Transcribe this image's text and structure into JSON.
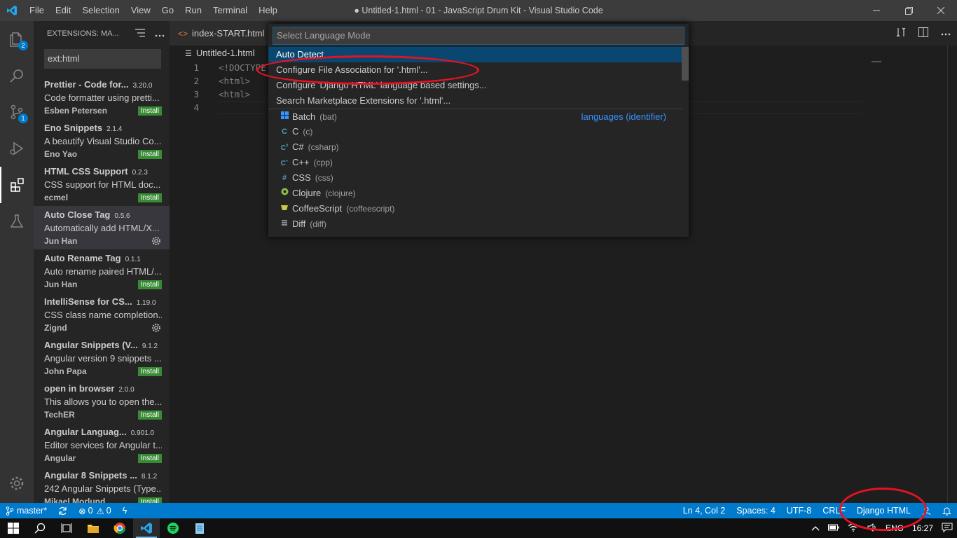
{
  "titlebar": {
    "menu": [
      "File",
      "Edit",
      "Selection",
      "View",
      "Go",
      "Run",
      "Terminal",
      "Help"
    ],
    "title": "● Untitled-1.html - 01 - JavaScript Drum Kit - Visual Studio Code"
  },
  "activitybar": {
    "explorer_badge": "2",
    "scm_badge": "1"
  },
  "sidebar": {
    "title": "EXTENSIONS: MA...",
    "search_value": "ext:html",
    "extensions": [
      {
        "name": "Prettier - Code for...",
        "version": "3.20.0",
        "desc": "Code formatter using pretti...",
        "author": "Esben Petersen",
        "action": "Install"
      },
      {
        "name": "Eno Snippets",
        "version": "2.1.4",
        "desc": "A beautify Visual Studio Co...",
        "author": "Eno Yao",
        "action": "Install"
      },
      {
        "name": "HTML CSS Support",
        "version": "0.2.3",
        "desc": "CSS support for HTML doc...",
        "author": "ecmel",
        "action": "Install"
      },
      {
        "name": "Auto Close Tag",
        "version": "0.5.6",
        "desc": "Automatically add HTML/X...",
        "author": "Jun Han",
        "action": ""
      },
      {
        "name": "Auto Rename Tag",
        "version": "0.1.1",
        "desc": "Auto rename paired HTML/...",
        "author": "Jun Han",
        "action": "Install"
      },
      {
        "name": "IntelliSense for CS...",
        "version": "1.19.0",
        "desc": "CSS class name completion...",
        "author": "Zignd",
        "action": ""
      },
      {
        "name": "Angular Snippets (V...",
        "version": "9.1.2",
        "desc": "Angular version 9 snippets ...",
        "author": "John Papa",
        "action": "Install"
      },
      {
        "name": "open in browser",
        "version": "2.0.0",
        "desc": "This allows you to open the...",
        "author": "TechER",
        "action": "Install"
      },
      {
        "name": "Angular Languag...",
        "version": "0.901.0",
        "desc": "Editor services for Angular t...",
        "author": "Angular",
        "action": "Install"
      },
      {
        "name": "Angular 8 Snippets ...",
        "version": "8.1.2",
        "desc": "242 Angular Snippets (Type...",
        "author": "Mikael Morlund",
        "action": "Install"
      }
    ]
  },
  "editor": {
    "tab_label": "index-START.html",
    "breadcrumb": "Untitled-1.html",
    "lines": [
      {
        "num": "1",
        "text": "<!DOCTYPE"
      },
      {
        "num": "2",
        "text": "<html>"
      },
      {
        "num": "3",
        "text": "<html>"
      },
      {
        "num": "4",
        "text": ""
      }
    ]
  },
  "quickpick": {
    "placeholder": "Select Language Mode",
    "actions": [
      "Auto Detect",
      "Configure File Association for '.html'...",
      "Configure 'Django HTML' language based settings...",
      "Search Marketplace Extensions for '.html'..."
    ],
    "separator_label": "languages (identifier)",
    "languages": [
      {
        "name": "Batch",
        "id": "(bat)",
        "icon": "windows-icon",
        "color": "#3794ff"
      },
      {
        "name": "C",
        "id": "(c)",
        "icon": "c-icon",
        "color": "#519aba"
      },
      {
        "name": "C#",
        "id": "(csharp)",
        "icon": "csharp-icon",
        "color": "#519aba"
      },
      {
        "name": "C++",
        "id": "(cpp)",
        "icon": "cpp-icon",
        "color": "#519aba"
      },
      {
        "name": "CSS",
        "id": "(css)",
        "icon": "hash-icon",
        "color": "#519aba"
      },
      {
        "name": "Clojure",
        "id": "(clojure)",
        "icon": "clojure-icon",
        "color": "#8dc149"
      },
      {
        "name": "CoffeeScript",
        "id": "(coffeescript)",
        "icon": "coffee-icon",
        "color": "#cbcb41"
      },
      {
        "name": "Diff",
        "id": "(diff)",
        "icon": "diff-icon",
        "color": "#cccccc"
      }
    ]
  },
  "statusbar": {
    "branch": "master*",
    "errors": "0",
    "warnings": "0",
    "position": "Ln 4, Col 2",
    "spaces": "Spaces: 4",
    "encoding": "UTF-8",
    "eol": "CRLF",
    "language": "Django HTML"
  },
  "taskbar": {
    "lang": "ENG",
    "time": "16:27"
  },
  "colors": {
    "accent": "#007acc",
    "install": "#388a34",
    "annotation": "#e81123"
  }
}
